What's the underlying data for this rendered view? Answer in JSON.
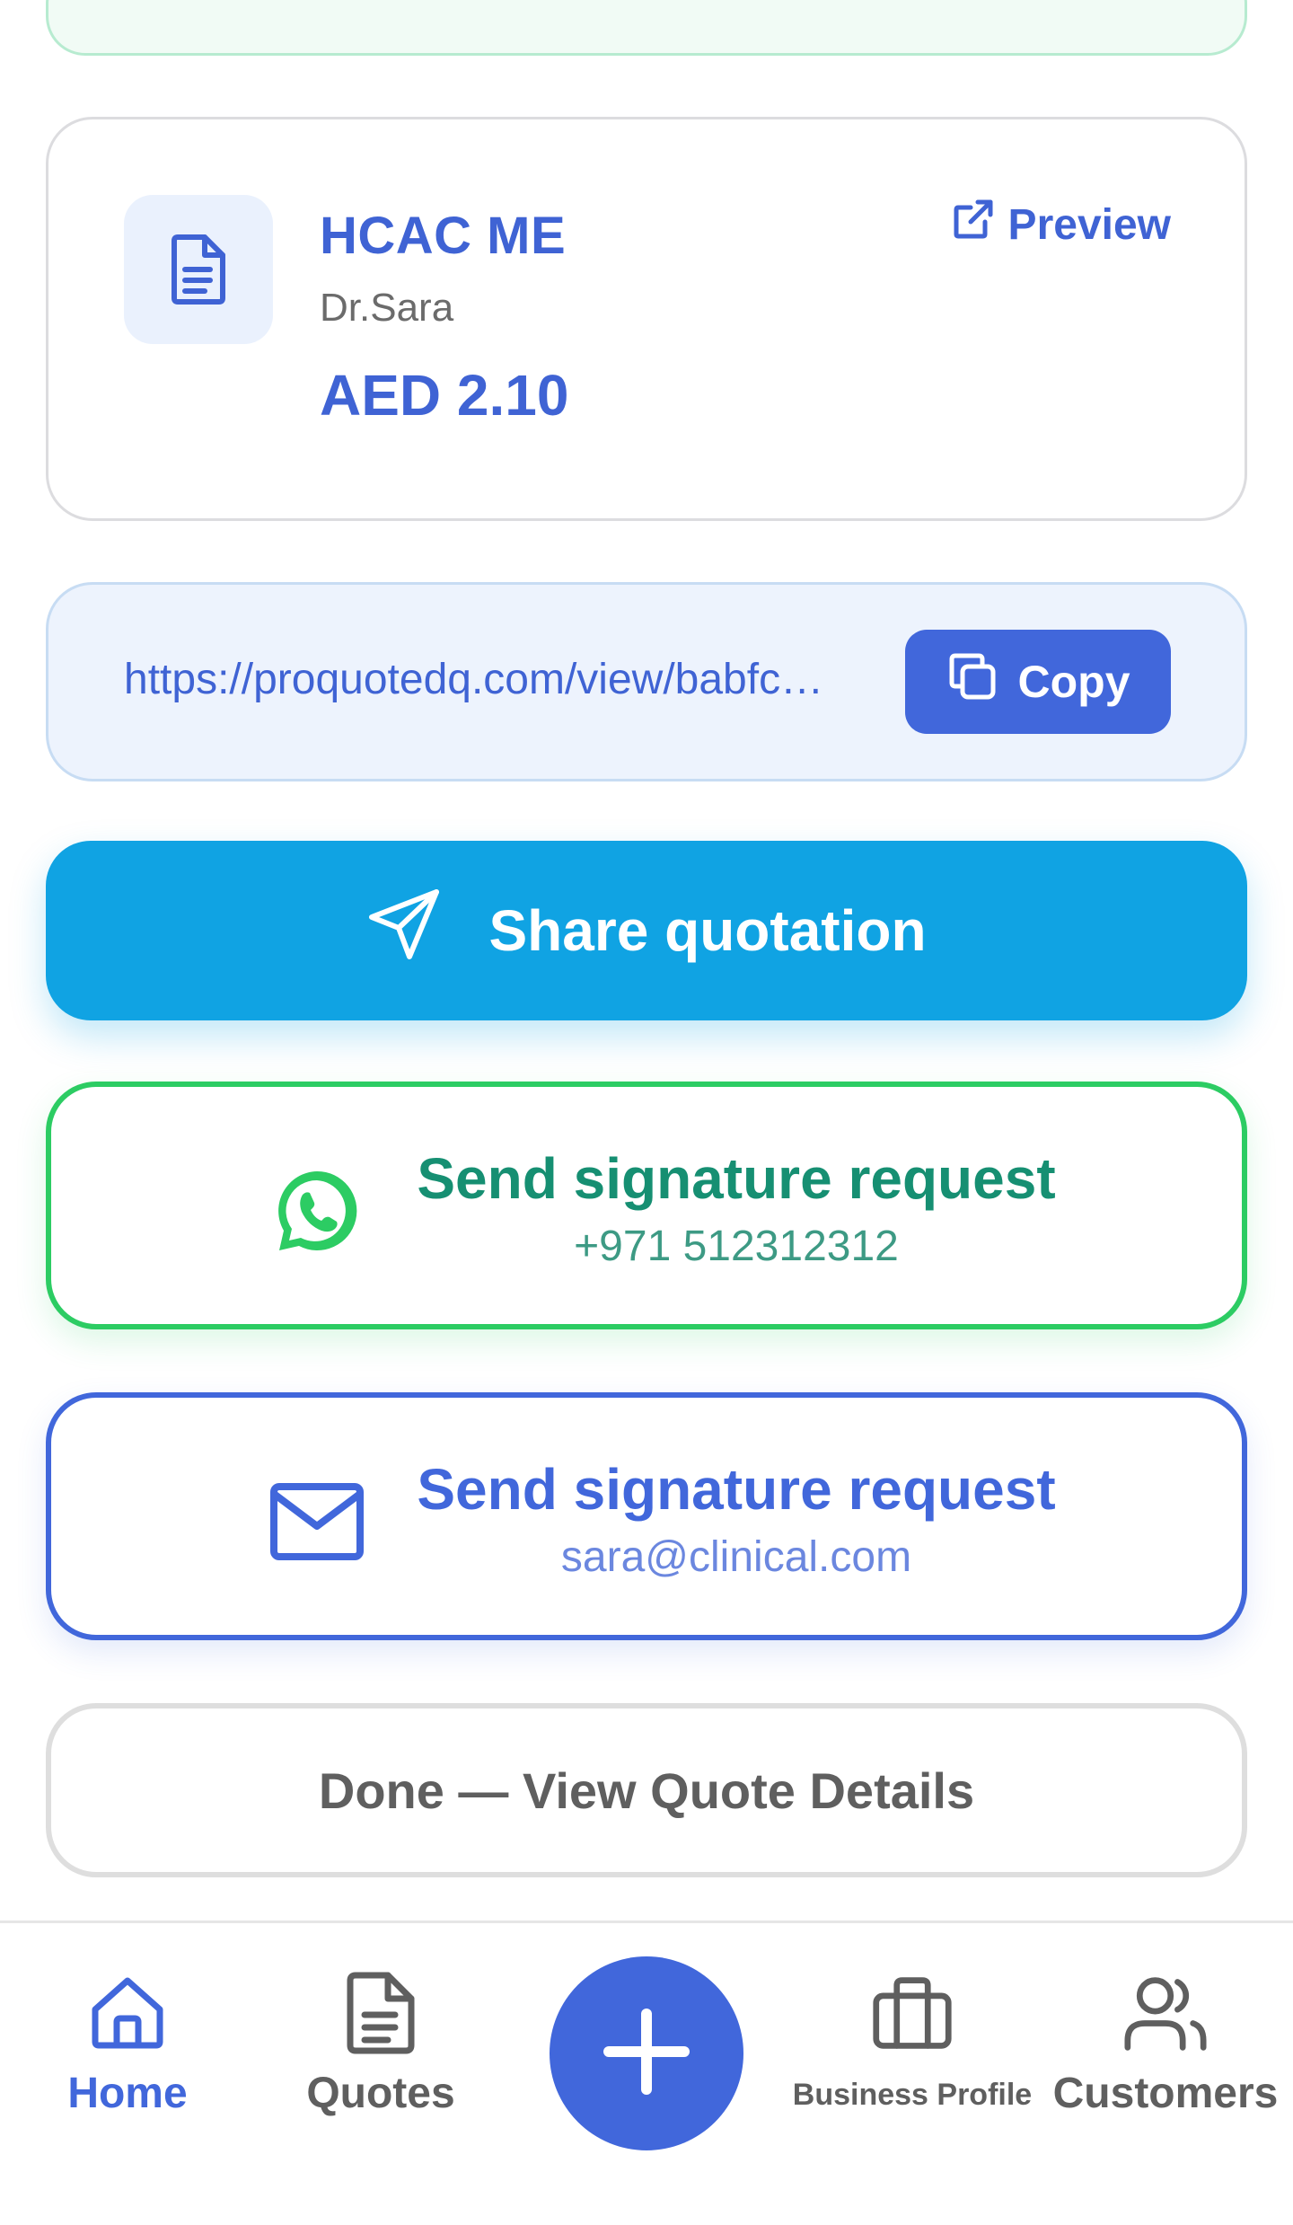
{
  "colors": {
    "primary": "#4167db",
    "share": "#10a3e3",
    "whatsapp": "#2ccc63",
    "whatsapp_text": "#168f72",
    "muted": "#5f5f5f"
  },
  "quote": {
    "icon": "document-icon",
    "title": "HCAC ME",
    "customer": "Dr.Sara",
    "amount": "AED 2.10",
    "preview_label": "Preview"
  },
  "link": {
    "url": "https://proquotedq.com/view/babfc…",
    "copy_label": "Copy"
  },
  "share": {
    "label": "Share quotation"
  },
  "whatsapp_request": {
    "title": "Send signature request",
    "subtitle": "+971 512312312"
  },
  "email_request": {
    "title": "Send signature request",
    "subtitle": "sara@clinical.com"
  },
  "done": {
    "label": "Done — View Quote Details"
  },
  "nav": {
    "items": [
      {
        "label": "Home",
        "icon": "home-icon",
        "active": true
      },
      {
        "label": "Quotes",
        "icon": "quotes-icon",
        "active": false
      },
      {
        "label": "Business Profile",
        "icon": "briefcase-icon",
        "active": false
      },
      {
        "label": "Customers",
        "icon": "users-icon",
        "active": false
      }
    ],
    "fab_icon": "plus-icon"
  }
}
